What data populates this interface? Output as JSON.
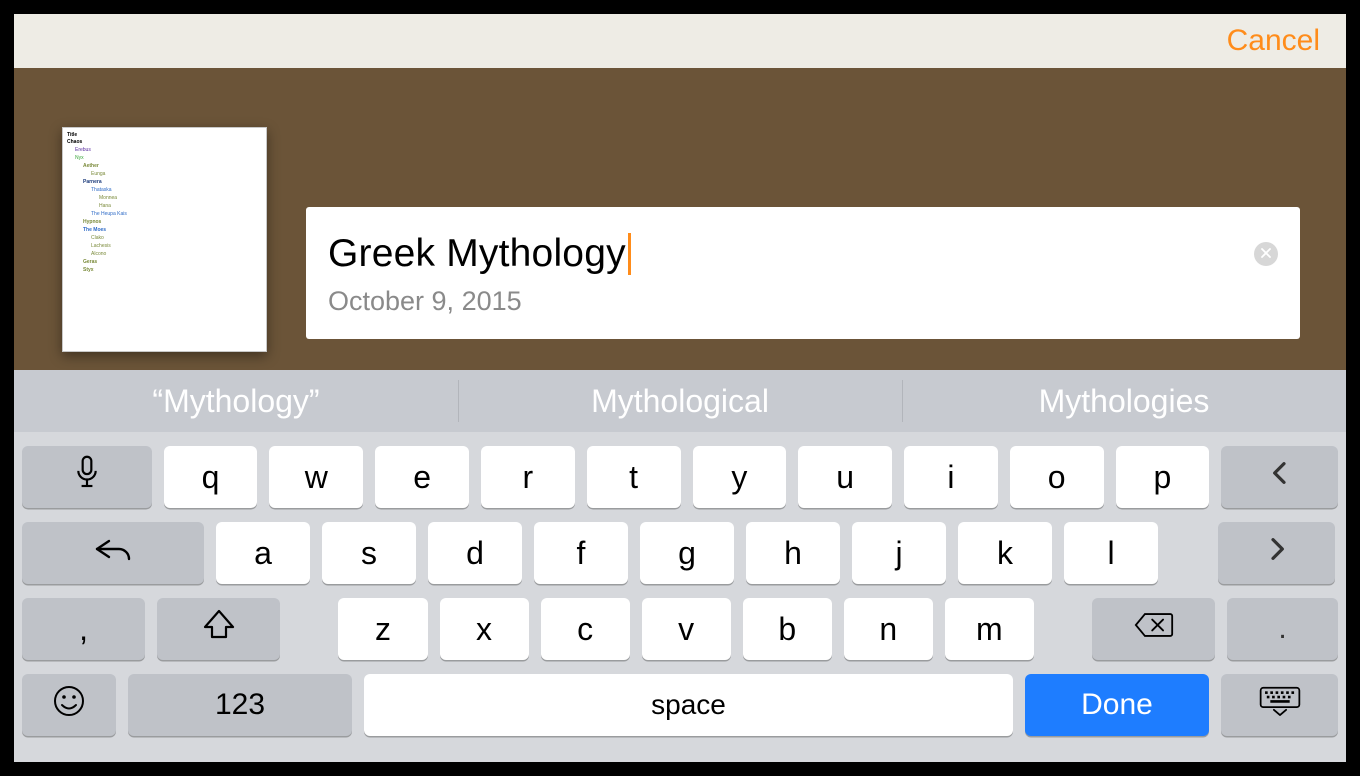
{
  "navbar": {
    "cancel_label": "Cancel"
  },
  "thumb": {
    "header": "Title",
    "items": [
      {
        "text": "Chaos",
        "cls": "lv0"
      },
      {
        "text": "Erebus",
        "cls": "lv1 c-purple"
      },
      {
        "text": "Nyx",
        "cls": "lv1 c-green"
      },
      {
        "text": "Aether",
        "cls": "lv2 c-olive"
      },
      {
        "text": "Eunga",
        "cls": "lv3 c-olive"
      },
      {
        "text": "Parnera",
        "cls": "lv2 c-navy"
      },
      {
        "text": "Thataska",
        "cls": "lv3 c-blue"
      },
      {
        "text": "Monnea",
        "cls": "lv4 c-olive"
      },
      {
        "text": "Hana",
        "cls": "lv4 c-olive"
      },
      {
        "text": "The Heupa Kais",
        "cls": "lv3 c-blue"
      },
      {
        "text": "Hypnos",
        "cls": "lv2 c-olive"
      },
      {
        "text": "The Moes",
        "cls": "lv2 c-blue"
      },
      {
        "text": "Clako",
        "cls": "lv3 c-olive"
      },
      {
        "text": "Lachesis",
        "cls": "lv3 c-olive"
      },
      {
        "text": "Alcono",
        "cls": "lv3 c-olive"
      },
      {
        "text": "Geras",
        "cls": "lv2 c-olive"
      },
      {
        "text": "Styx",
        "cls": "lv2 c-olive"
      }
    ]
  },
  "titlecard": {
    "title": "Greek Mythology",
    "date": "October 9, 2015"
  },
  "suggestions": {
    "items": [
      "“Mythology”",
      "Mythological",
      "Mythologies"
    ]
  },
  "keyboard": {
    "row1": [
      "q",
      "w",
      "e",
      "r",
      "t",
      "y",
      "u",
      "i",
      "o",
      "p"
    ],
    "row2": [
      "a",
      "s",
      "d",
      "f",
      "g",
      "h",
      "j",
      "k",
      "l"
    ],
    "row3": [
      "z",
      "x",
      "c",
      "v",
      "b",
      "n",
      "m"
    ],
    "comma": ",",
    "period": ".",
    "numbers_label": "123",
    "space_label": "space",
    "done_label": "Done"
  }
}
